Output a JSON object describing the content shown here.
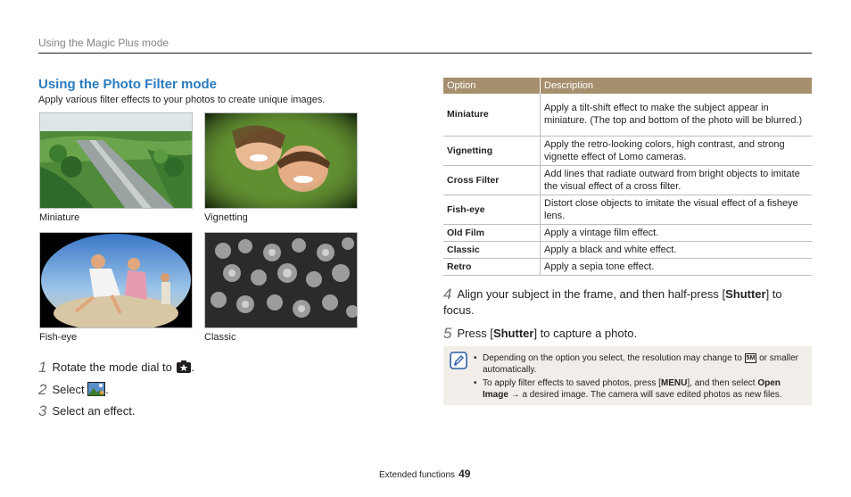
{
  "header": {
    "section_path": "Using the Magic Plus mode"
  },
  "section": {
    "title": "Using the Photo Filter mode",
    "intro": "Apply various filter effects to your photos to create unique images."
  },
  "photos": [
    {
      "caption": "Miniature"
    },
    {
      "caption": "Vignetting"
    },
    {
      "caption": "Fish-eye"
    },
    {
      "caption": "Classic"
    }
  ],
  "steps_left": [
    {
      "num": "1",
      "text": "Rotate the mode dial to",
      "suffix": ".",
      "icon": "magic-plus-mode-icon"
    },
    {
      "num": "2",
      "text": "Select",
      "suffix": ".",
      "icon": "photo-filter-icon"
    },
    {
      "num": "3",
      "text": "Select an effect."
    }
  ],
  "table": {
    "headers": [
      "Option",
      "Description"
    ],
    "rows": [
      {
        "option": "Miniature",
        "description": "Apply a tilt-shift effect to make the subject appear in miniature. (The top and bottom of the photo will be blurred.)"
      },
      {
        "option": "Vignetting",
        "description": "Apply the retro-looking colors, high contrast, and strong vignette effect of Lomo cameras."
      },
      {
        "option": "Cross Filter",
        "description": "Add lines that radiate outward from bright objects to imitate the visual effect of a cross filter."
      },
      {
        "option": "Fish-eye",
        "description": "Distort close objects to imitate the visual effect of a fisheye lens."
      },
      {
        "option": "Old Film",
        "description": "Apply a vintage film effect."
      },
      {
        "option": "Classic",
        "description": "Apply a black and white effect."
      },
      {
        "option": "Retro",
        "description": "Apply a sepia tone effect."
      }
    ]
  },
  "steps_right": [
    {
      "num": "4",
      "before": "Align your subject in the frame, and then half-press [",
      "key": "Shutter",
      "after": "] to focus."
    },
    {
      "num": "5",
      "before": "Press [",
      "key": "Shutter",
      "after": "] to capture a photo."
    }
  ],
  "note": {
    "icon": "note-pencil-icon",
    "item1_before": "Depending on the option you select, the resolution may change to",
    "item1_icon_text": "5M",
    "item1_after": "or smaller automatically.",
    "item2_before": "To apply filter effects to saved photos, press [",
    "item2_key": "MENU",
    "item2_mid": "], and then select",
    "item2_bold": "Open Image",
    "item2_arrow": "→",
    "item2_after": "a desired image. The camera will save edited photos as new files."
  },
  "footer": {
    "label": "Extended functions",
    "page": "49"
  },
  "colors": {
    "title_blue": "#2b7bbf",
    "table_header": "#a68f6e",
    "note_bg": "#f1ede8"
  }
}
